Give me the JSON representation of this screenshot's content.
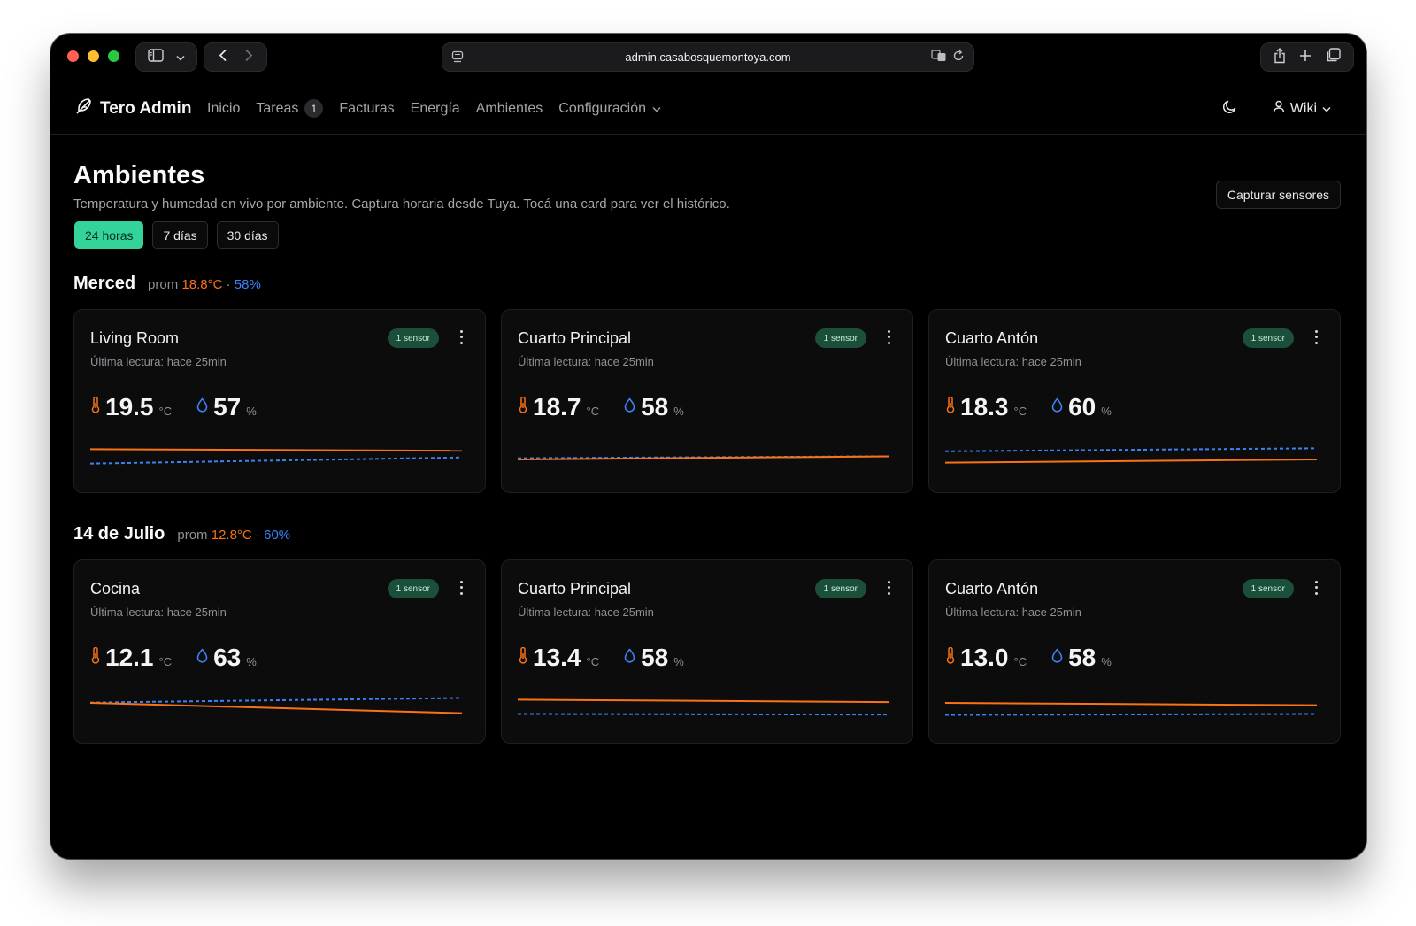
{
  "browser": {
    "url": "admin.casabosquemontoya.com"
  },
  "nav": {
    "brand": "Tero Admin",
    "links": [
      {
        "label": "Inicio"
      },
      {
        "label": "Tareas",
        "count": "1"
      },
      {
        "label": "Facturas"
      },
      {
        "label": "Energía"
      },
      {
        "label": "Ambientes"
      },
      {
        "label": "Configuración"
      }
    ],
    "user": "Wiki"
  },
  "page": {
    "title": "Ambientes",
    "subtitle": "Temperatura y humedad en vivo por ambiente. Captura horaria desde Tuya. Tocá una card para ver el histórico.",
    "capture_button": "Capturar sensores",
    "ranges": [
      {
        "label": "24 horas",
        "active": true
      },
      {
        "label": "7 días",
        "active": false
      },
      {
        "label": "30 días",
        "active": false
      }
    ]
  },
  "colors": {
    "temperature": "#f97316",
    "humidity": "#3b82f6",
    "accent": "#34d399"
  },
  "groups": [
    {
      "name": "Merced",
      "avg_prefix": "prom",
      "avg_temp": "18.8°C",
      "sep": "·",
      "avg_hum": "58%",
      "rooms": [
        {
          "title": "Living Room",
          "sensors": "1 sensor",
          "last": "Última lectura: hace 25min",
          "temp": "19.5",
          "temp_unit": "°C",
          "hum": "57",
          "hum_unit": "%",
          "temp_series": [
            19.7,
            19.5
          ],
          "hum_series": [
            56.2,
            57.8
          ]
        },
        {
          "title": "Cuarto Principal",
          "sensors": "1 sensor",
          "last": "Última lectura: hace 25min",
          "temp": "18.7",
          "temp_unit": "°C",
          "hum": "58",
          "hum_unit": "%",
          "temp_series": [
            18.4,
            18.8
          ],
          "hum_series": [
            57.6,
            58.1
          ]
        },
        {
          "title": "Cuarto Antón",
          "sensors": "1 sensor",
          "last": "Última lectura: hace 25min",
          "temp": "18.3",
          "temp_unit": "°C",
          "hum": "60",
          "hum_unit": "%",
          "temp_series": [
            18.0,
            18.4
          ],
          "hum_series": [
            59.4,
            60.2
          ]
        }
      ]
    },
    {
      "name": "14 de Julio",
      "avg_prefix": "prom",
      "avg_temp": "12.8°C",
      "sep": "·",
      "avg_hum": "60%",
      "rooms": [
        {
          "title": "Cocina",
          "sensors": "1 sensor",
          "last": "Última lectura: hace 25min",
          "temp": "12.1",
          "temp_unit": "°C",
          "hum": "63",
          "hum_unit": "%",
          "temp_series": [
            13.2,
            11.9
          ],
          "hum_series": [
            61.8,
            63.3
          ]
        },
        {
          "title": "Cuarto Principal",
          "sensors": "1 sensor",
          "last": "Última lectura: hace 25min",
          "temp": "13.4",
          "temp_unit": "°C",
          "hum": "58",
          "hum_unit": "%",
          "temp_series": [
            13.6,
            13.3
          ],
          "hum_series": [
            58.1,
            57.9
          ]
        },
        {
          "title": "Cuarto Antón",
          "sensors": "1 sensor",
          "last": "Última lectura: hace 25min",
          "temp": "13.0",
          "temp_unit": "°C",
          "hum": "58",
          "hum_unit": "%",
          "temp_series": [
            13.2,
            12.9
          ],
          "hum_series": [
            57.8,
            58.1
          ]
        }
      ]
    }
  ]
}
